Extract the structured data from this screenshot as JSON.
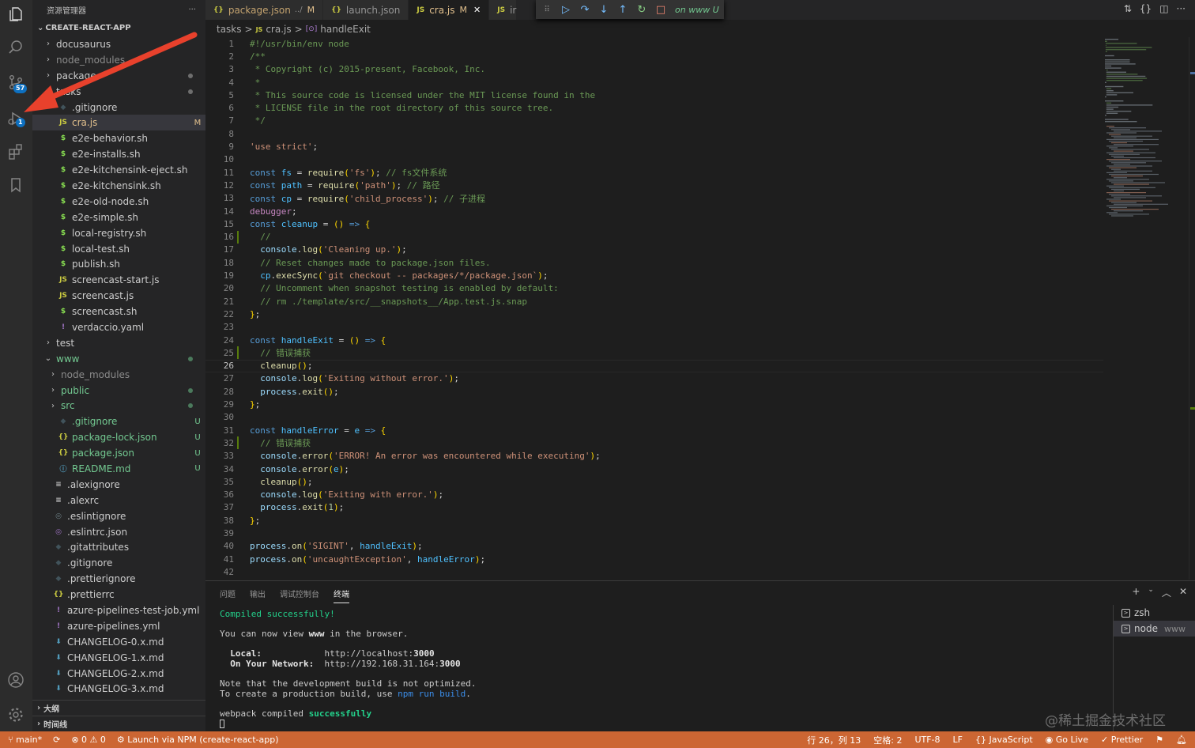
{
  "sidebar": {
    "title": "资源管理器",
    "more": "···",
    "project": "CREATE-REACT-APP",
    "items": [
      {
        "name": "docusaurus",
        "kind": "folder",
        "open": false,
        "indent": 1
      },
      {
        "name": "node_modules",
        "kind": "folder",
        "open": false,
        "indent": 1,
        "dim": true
      },
      {
        "name": "package",
        "kind": "folder",
        "open": false,
        "indent": 1,
        "dot": true
      },
      {
        "name": "tasks",
        "kind": "folder",
        "open": true,
        "indent": 1,
        "dot": true
      },
      {
        "name": ".gitignore",
        "kind": "git",
        "indent": 2
      },
      {
        "name": "cra.js",
        "kind": "js",
        "indent": 2,
        "status": "M",
        "selected": true
      },
      {
        "name": "e2e-behavior.sh",
        "kind": "sh",
        "indent": 2
      },
      {
        "name": "e2e-installs.sh",
        "kind": "sh",
        "indent": 2
      },
      {
        "name": "e2e-kitchensink-eject.sh",
        "kind": "sh",
        "indent": 2
      },
      {
        "name": "e2e-kitchensink.sh",
        "kind": "sh",
        "indent": 2
      },
      {
        "name": "e2e-old-node.sh",
        "kind": "sh",
        "indent": 2
      },
      {
        "name": "e2e-simple.sh",
        "kind": "sh",
        "indent": 2
      },
      {
        "name": "local-registry.sh",
        "kind": "sh",
        "indent": 2
      },
      {
        "name": "local-test.sh",
        "kind": "sh",
        "indent": 2
      },
      {
        "name": "publish.sh",
        "kind": "sh",
        "indent": 2
      },
      {
        "name": "screencast-start.js",
        "kind": "js",
        "indent": 2
      },
      {
        "name": "screencast.js",
        "kind": "js",
        "indent": 2
      },
      {
        "name": "screencast.sh",
        "kind": "sh",
        "indent": 2
      },
      {
        "name": "verdaccio.yaml",
        "kind": "yaml",
        "indent": 2
      },
      {
        "name": "test",
        "kind": "folder",
        "open": false,
        "indent": 1
      },
      {
        "name": "www",
        "kind": "folder",
        "open": true,
        "indent": 1,
        "dot": true,
        "untracked": true
      },
      {
        "name": "node_modules",
        "kind": "folder",
        "open": false,
        "indent": 2,
        "dim": true
      },
      {
        "name": "public",
        "kind": "folder",
        "open": false,
        "indent": 2,
        "dot": true,
        "untracked": true
      },
      {
        "name": "src",
        "kind": "folder",
        "open": false,
        "indent": 2,
        "dot": true,
        "untracked": true
      },
      {
        "name": ".gitignore",
        "kind": "git",
        "indent": 2,
        "status": "U",
        "untracked": true
      },
      {
        "name": "package-lock.json",
        "kind": "json",
        "indent": 2,
        "status": "U",
        "untracked": true
      },
      {
        "name": "package.json",
        "kind": "json",
        "indent": 2,
        "status": "U",
        "untracked": true
      },
      {
        "name": "README.md",
        "kind": "info",
        "indent": 2,
        "status": "U",
        "untracked": true
      },
      {
        "name": ".alexignore",
        "kind": "text",
        "indent": 1
      },
      {
        "name": ".alexrc",
        "kind": "text",
        "indent": 1
      },
      {
        "name": ".eslintignore",
        "kind": "eslint",
        "indent": 1
      },
      {
        "name": ".eslintrc.json",
        "kind": "eslintp",
        "indent": 1
      },
      {
        "name": ".gitattributes",
        "kind": "git",
        "indent": 1
      },
      {
        "name": ".gitignore",
        "kind": "git",
        "indent": 1
      },
      {
        "name": ".prettierignore",
        "kind": "git",
        "indent": 1
      },
      {
        "name": ".prettierrc",
        "kind": "json",
        "indent": 1
      },
      {
        "name": "azure-pipelines-test-job.yml",
        "kind": "yaml",
        "indent": 1
      },
      {
        "name": "azure-pipelines.yml",
        "kind": "yaml",
        "indent": 1
      },
      {
        "name": "CHANGELOG-0.x.md",
        "kind": "md",
        "indent": 1
      },
      {
        "name": "CHANGELOG-1.x.md",
        "kind": "md",
        "indent": 1
      },
      {
        "name": "CHANGELOG-2.x.md",
        "kind": "md",
        "indent": 1
      },
      {
        "name": "CHANGELOG-3.x.md",
        "kind": "md",
        "indent": 1
      }
    ],
    "outline": "大纲",
    "timeline": "时间线"
  },
  "activity": {
    "scm_badge": "57",
    "debug_badge": "1"
  },
  "tabs": [
    {
      "icon": "{}",
      "label": "package.json",
      "extra": "../",
      "status": "M",
      "active": false
    },
    {
      "icon": "{}",
      "label": "launch.json",
      "extra": "",
      "status": "",
      "active": false
    },
    {
      "icon": "JS",
      "label": "cra.js",
      "extra": "",
      "status": "M",
      "active": true,
      "close": "✕"
    },
    {
      "icon": "JS",
      "label": "ir",
      "extra": "",
      "status": "",
      "active": false
    }
  ],
  "tab_hidden_label": "on www U",
  "breadcrumb": {
    "folder": "tasks",
    "file": "cra.js",
    "symbol": "handleExit",
    "sep": ">"
  },
  "editor": {
    "current_line": 26,
    "lines": [
      "#!/usr/bin/env node",
      "/**",
      " * Copyright (c) 2015-present, Facebook, Inc.",
      " *",
      " * This source code is licensed under the MIT license found in the",
      " * LICENSE file in the root directory of this source tree.",
      " */",
      "",
      "'use strict';",
      "",
      "const fs = require('fs'); // fs文件系统",
      "const path = require('path'); // 路径",
      "const cp = require('child_process'); // 子进程",
      "debugger;",
      "const cleanup = () => {",
      "  //",
      "  console.log('Cleaning up.');",
      "  // Reset changes made to package.json files.",
      "  cp.execSync(`git checkout -- packages/*/package.json`);",
      "  // Uncomment when snapshot testing is enabled by default:",
      "  // rm ./template/src/__snapshots__/App.test.js.snap",
      "};",
      "",
      "const handleExit = () => {",
      "  // 错误捕获",
      "  cleanup();",
      "  console.log('Exiting without error.');",
      "  process.exit();",
      "};",
      "",
      "const handleError = e => {",
      "  // 错误捕获",
      "  console.error('ERROR! An error was encountered while executing');",
      "  console.error(e);",
      "  cleanup();",
      "  console.log('Exiting with error.');",
      "  process.exit(1);",
      "};",
      "",
      "process.on('SIGINT', handleExit);",
      "process.on('uncaughtException', handleError);",
      ""
    ],
    "modified_lines": [
      16,
      25,
      32
    ]
  },
  "panel": {
    "tabs": [
      {
        "label": "问题",
        "active": false
      },
      {
        "label": "输出",
        "active": false
      },
      {
        "label": "调试控制台",
        "active": false
      },
      {
        "label": "终端",
        "active": true
      }
    ],
    "terminal": {
      "compiled": "Compiled successfully!",
      "view_prefix": "You can now view ",
      "view_app": "www",
      "view_suffix": " in the browser.",
      "local_label": "Local:",
      "local_url_base": "http://localhost:",
      "local_port": "3000",
      "network_label": "On Your Network:",
      "network_url_base": "http://192.168.31.164:",
      "network_port": "3000",
      "note1": "Note that the development build is not optimized.",
      "note2_prefix": "To create a production build, use ",
      "note2_cmd": "npm run build",
      "note2_suffix": ".",
      "webpack_prefix": "webpack compiled ",
      "webpack_status": "successfully"
    },
    "terminal_list": [
      {
        "label": "zsh",
        "sub": "",
        "active": false
      },
      {
        "label": "node",
        "sub": "www",
        "active": true
      }
    ]
  },
  "status": {
    "branch": "main*",
    "errors": "0",
    "warnings": "0",
    "launch": "Launch via NPM (create-react-app)",
    "position": "行 26，列 13",
    "spaces": "空格: 2",
    "encoding": "UTF-8",
    "eol": "LF",
    "language": "JavaScript",
    "golive": "Go Live",
    "prettier": "Prettier"
  },
  "watermark": "@稀土掘金技术社区",
  "colors": {
    "accent": "#0e70c0",
    "status_bar": "#cc6633",
    "modified": "#e2c08d",
    "untracked": "#73c991",
    "arrow": "#e8412c"
  }
}
